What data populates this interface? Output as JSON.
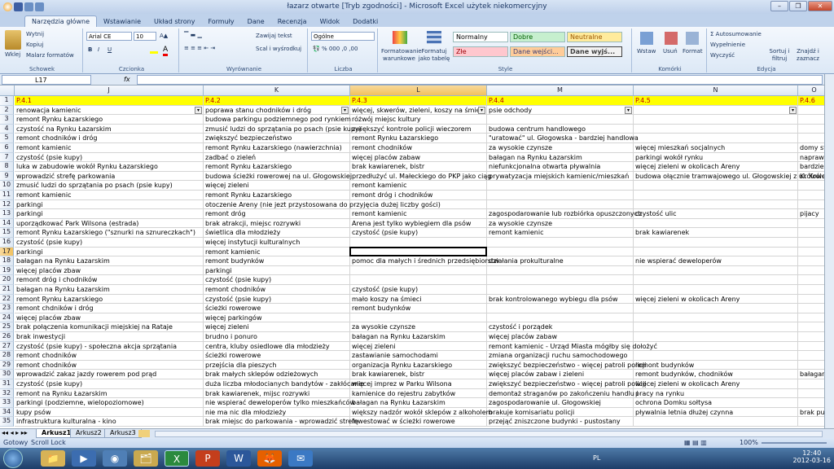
{
  "window": {
    "title": "łazarz otwarte  [Tryb zgodności] - Microsoft Excel użytek niekomercyjny"
  },
  "ribbon_tabs": [
    "Narzędzia główne",
    "Wstawianie",
    "Układ strony",
    "Formuły",
    "Dane",
    "Recenzja",
    "Widok",
    "Dodatki"
  ],
  "ribbon": {
    "clipboard": {
      "paste": "Wklej",
      "cut": "Wytnij",
      "copy": "Kopiuj",
      "format_painter": "Malarz formatów",
      "label": "Schowek"
    },
    "font": {
      "name": "Arial CE",
      "size": "10",
      "label": "Czcionka"
    },
    "alignment": {
      "wrap": "Zawijaj tekst",
      "merge": "Scal i wyśrodkuj",
      "label": "Wyrównanie"
    },
    "number": {
      "format": "Ogólne",
      "label": "Liczba"
    },
    "styles": {
      "cond_format": "Formatowanie warunkowe",
      "format_table": "Formatuj jako tabelę",
      "normal": "Normalny",
      "good": "Dobre",
      "neutral": "Neutralne",
      "bad": "Złe",
      "input": "Dane wejści...",
      "output": "Dane wyjś...",
      "label": "Style"
    },
    "cells": {
      "insert": "Wstaw",
      "delete": "Usuń",
      "format": "Format",
      "label": "Komórki"
    },
    "editing": {
      "autosum": "Autosumowanie",
      "fill": "Wypełnienie",
      "clear": "Wyczyść",
      "sort": "Sortuj i filtruj",
      "find": "Znajdź i zaznacz",
      "label": "Edycja"
    }
  },
  "formula_bar": {
    "name_box": "L17",
    "fx": "fx",
    "value": ""
  },
  "columns": [
    "J",
    "K",
    "L",
    "M",
    "N"
  ],
  "rows": [
    {
      "n": "1",
      "J": "P.4.1",
      "K": "P.4.2",
      "L": "P.4.3",
      "M": "P.4.4",
      "N": "P.4.5",
      "O": "P.4.6"
    },
    {
      "n": "2",
      "J": "renowacja kamienic",
      "K": "poprawa stanu chodników i dróg",
      "L": "więcej, skwerów, zieleni, koszy na śmieci",
      "M": "psie odchody",
      "N": "",
      "O": ""
    },
    {
      "n": "3",
      "J": "remont Rynku Łazarskiego",
      "K": "budowa parkingu podziemnego pod rynkiem",
      "L": "różwój miejsc kultury",
      "M": "",
      "N": "",
      "O": ""
    },
    {
      "n": "4",
      "J": "czystość na Rynku Łazarskim",
      "K": "zmusić ludzi do sprzątania po psach (psie kupy)",
      "L": "zwiększyć kontrole policji wieczorem",
      "M": "budowa centrum handlowego",
      "N": "",
      "O": ""
    },
    {
      "n": "5",
      "J": "remont chodników i dróg",
      "K": "zwiększyć bezpieczeństwo",
      "L": "remont Rynku Łazarskiego",
      "M": "\"uratować\" ul. Głogowska - bardziej handlowa",
      "N": "",
      "O": ""
    },
    {
      "n": "6",
      "J": "remont kamienic",
      "K": "remont Rynku Łazarskiego (nawierzchnia)",
      "L": "remont chodników",
      "M": "za wysokie czynsze",
      "N": "więcej mieszkań socjalnych",
      "O": "domy st"
    },
    {
      "n": "7",
      "J": "czystość (psie kupy)",
      "K": "zadbać o zieleń",
      "L": "więcej placów zabaw",
      "M": "bałagan na Rynku Łazarskim",
      "N": "parkingi wokół rynku",
      "O": "napraw"
    },
    {
      "n": "8",
      "J": "luka w zabudowie wokół Rynku Łazarskiego",
      "K": "remont Rynku Łazarskiego",
      "L": "brak kawiarenek, bistr",
      "M": "niefunkcjonalna otwarta pływalnia",
      "N": "więcej zieleni w okolicach Areny",
      "O": "bardzie"
    },
    {
      "n": "9",
      "J": "wprowadzić strefę parkowania",
      "K": "budowa ścieżki rowerowej na ul. Głogowskiej",
      "L": "przedłużyć ul. Małeckiego do PKP jako ciąg",
      "M": "prywatyzacja miejskich kamienic/mieszkań",
      "N": "budowa ołącznie tramwajowego ul. Głogowskiej z ul. Królowej",
      "O": "Królowe"
    },
    {
      "n": "10",
      "J": "zmusić ludzi do sprzątania po psach (psie kupy)",
      "K": "więcej zieleni",
      "L": "remont kamienic",
      "M": "",
      "N": "",
      "O": ""
    },
    {
      "n": "11",
      "J": "remont kamienic",
      "K": "remont Rynku Łazarskiego",
      "L": "remont dróg i chodników",
      "M": "",
      "N": "",
      "O": ""
    },
    {
      "n": "12",
      "J": "parkingi",
      "K": "otoczenie Areny (nie jezt przystosowana do przyjęcia dużej liczby gości)",
      "L": "",
      "M": "",
      "N": "",
      "O": ""
    },
    {
      "n": "13",
      "J": "parkingi",
      "K": "remont dróg",
      "L": "remont kamienic",
      "M": "zagospodarowanie lub rozbiórka opuszczonych",
      "N": "czystość ulic",
      "O": "pijacy"
    },
    {
      "n": "14",
      "J": "uporządkować Park Wilsona (estrada)",
      "K": "brak atrakcji, miejsc rozrywki",
      "L": "Arena jest tylko wybiegiem dla psów",
      "M": "za wysokie czynsze",
      "N": "",
      "O": ""
    },
    {
      "n": "15",
      "J": "remont Rynku Łazarskiego (\"sznurki na sznureczkach\")",
      "K": "świetlica dla młodzieży",
      "L": "czystość (psie kupy)",
      "M": "remont kamienic",
      "N": "brak kawiarenek",
      "O": ""
    },
    {
      "n": "16",
      "J": "czystość (psie kupy)",
      "K": "więcej instytucji kulturalnych",
      "L": "",
      "M": "",
      "N": "",
      "O": ""
    },
    {
      "n": "17",
      "J": "parkingi",
      "K": "remont kamienic",
      "L": "",
      "M": "",
      "N": "",
      "O": ""
    },
    {
      "n": "18",
      "J": "bałagan na Rynku Łazarskim",
      "K": "remont budynków",
      "L": "pomoc dla małych i średnich przedsiębiorstw",
      "M": "działania prokulturalne",
      "N": "nie wspierać deweloperów",
      "O": ""
    },
    {
      "n": "19",
      "J": "więcej placów zbaw",
      "K": "parkingi",
      "L": "",
      "M": "",
      "N": "",
      "O": ""
    },
    {
      "n": "20",
      "J": "remont dróg i chodników",
      "K": "czystość (psie kupy)",
      "L": "",
      "M": "",
      "N": "",
      "O": ""
    },
    {
      "n": "21",
      "J": "bałagan na Rynku Łazarskim",
      "K": "remont chodników",
      "L": "czystość (psie kupy)",
      "M": "",
      "N": "",
      "O": ""
    },
    {
      "n": "22",
      "J": "remont Rynku Łazarskiego",
      "K": "czystość (psie kupy)",
      "L": "mało koszy na śmieci",
      "M": "brak kontrolowanego wybiegu dla psów",
      "N": "więcej zieleni w okolicach Areny",
      "O": ""
    },
    {
      "n": "23",
      "J": "remont chdników i dróg",
      "K": "ścieżki rowerowe",
      "L": "remont budynków",
      "M": "",
      "N": "",
      "O": ""
    },
    {
      "n": "24",
      "J": "więcej placów zbaw",
      "K": "więcej parkingów",
      "L": "",
      "M": "",
      "N": "",
      "O": ""
    },
    {
      "n": "25",
      "J": "brak połączenia komunikacji miejskiej na Ratajе",
      "K": "więcej zieleni",
      "L": "za wysokie czynsze",
      "M": "czystość i porządek",
      "N": "",
      "O": ""
    },
    {
      "n": "26",
      "J": "brak inwestycji",
      "K": "brudno i ponuro",
      "L": "bałagan na Rynku Łazarskim",
      "M": "więcej placów zabaw",
      "N": "",
      "O": ""
    },
    {
      "n": "27",
      "J": "czystość (psie kupy) - społeczna akcja sprzątania",
      "K": "centra, kluby osiedlowe dla młodzieży",
      "L": "więcej zieleni",
      "M": "remont kamienic - Urząd Miasta mógłby się dołożyć",
      "N": "",
      "O": ""
    },
    {
      "n": "28",
      "J": "remont chodników",
      "K": "ścieżki rowerowe",
      "L": "zastawianie samochodami",
      "M": "zmiana organizacji ruchu samochodowego",
      "N": "",
      "O": ""
    },
    {
      "n": "29",
      "J": "remont chodników",
      "K": "przejścia dla pieszych",
      "L": "organizacja Rynku Łazarskiego",
      "M": "zwiększyć bezpieczeństwo - więcej patroli policji",
      "N": "remont budynków",
      "O": ""
    },
    {
      "n": "30",
      "J": "wprowadzić zakaz jazdy rowerem pod prąd",
      "K": "brak małych sklepów odzieżowych",
      "L": "brak kawiarenek, bistr",
      "M": "więcej placów zabaw i zieleni",
      "N": "remont budynków, chodników",
      "O": "bałagan"
    },
    {
      "n": "31",
      "J": "czystość (psie kupy)",
      "K": "duża liczba młodocianych bandytów - zakłócanie",
      "L": "więcej imprez w Parku Wilsona",
      "M": "zwiększyć bezpieczeństwo - więcej patroli policji",
      "N": "więcej zieleni w okolicach Areny",
      "O": ""
    },
    {
      "n": "32",
      "J": "remont na Rynku Łazarskim",
      "K": "brak kawiarenek, mijsc rozrywki",
      "L": "kamienice do rejestru zabytków",
      "M": "demontaż straganów po zakończeniu handlu i",
      "N": "pracy na rynku",
      "O": ""
    },
    {
      "n": "33",
      "J": "parkingi (podziemne, wielopoziomowe)",
      "K": "nie wspierać deweloperów tylko mieszkańców",
      "L": "bałagan na Rynku Łazarskim",
      "M": "zagospodarowanie ul. Głogowskiej",
      "N": "ochrona Domku sołtysa",
      "O": ""
    },
    {
      "n": "34",
      "J": "kupy psów",
      "K": "nie ma nic dla młodzieży",
      "L": "większy nadzór wokół sklepów z alkoholem",
      "M": "brakuje komisariatu policji",
      "N": "pływalnia letnia dłużej czynna",
      "O": "brak pu"
    },
    {
      "n": "35",
      "J": "infrastruktura kulturalna - kino",
      "K": "brak miejsc do parkowania - wprowadzić strefę",
      "L": "inwestować w ścieżki rowerowe",
      "M": "przejąć zniszczone budynki - pustostany",
      "N": "",
      "O": ""
    }
  ],
  "sheets": [
    "Arkusz1",
    "Arkusz2",
    "Arkusz3"
  ],
  "status": {
    "mode": "Gotowy",
    "scroll": "Scroll Lock",
    "zoom": "100%"
  },
  "taskbar": {
    "lang": "PL",
    "time": "12:40",
    "date": "2012-03-16"
  }
}
